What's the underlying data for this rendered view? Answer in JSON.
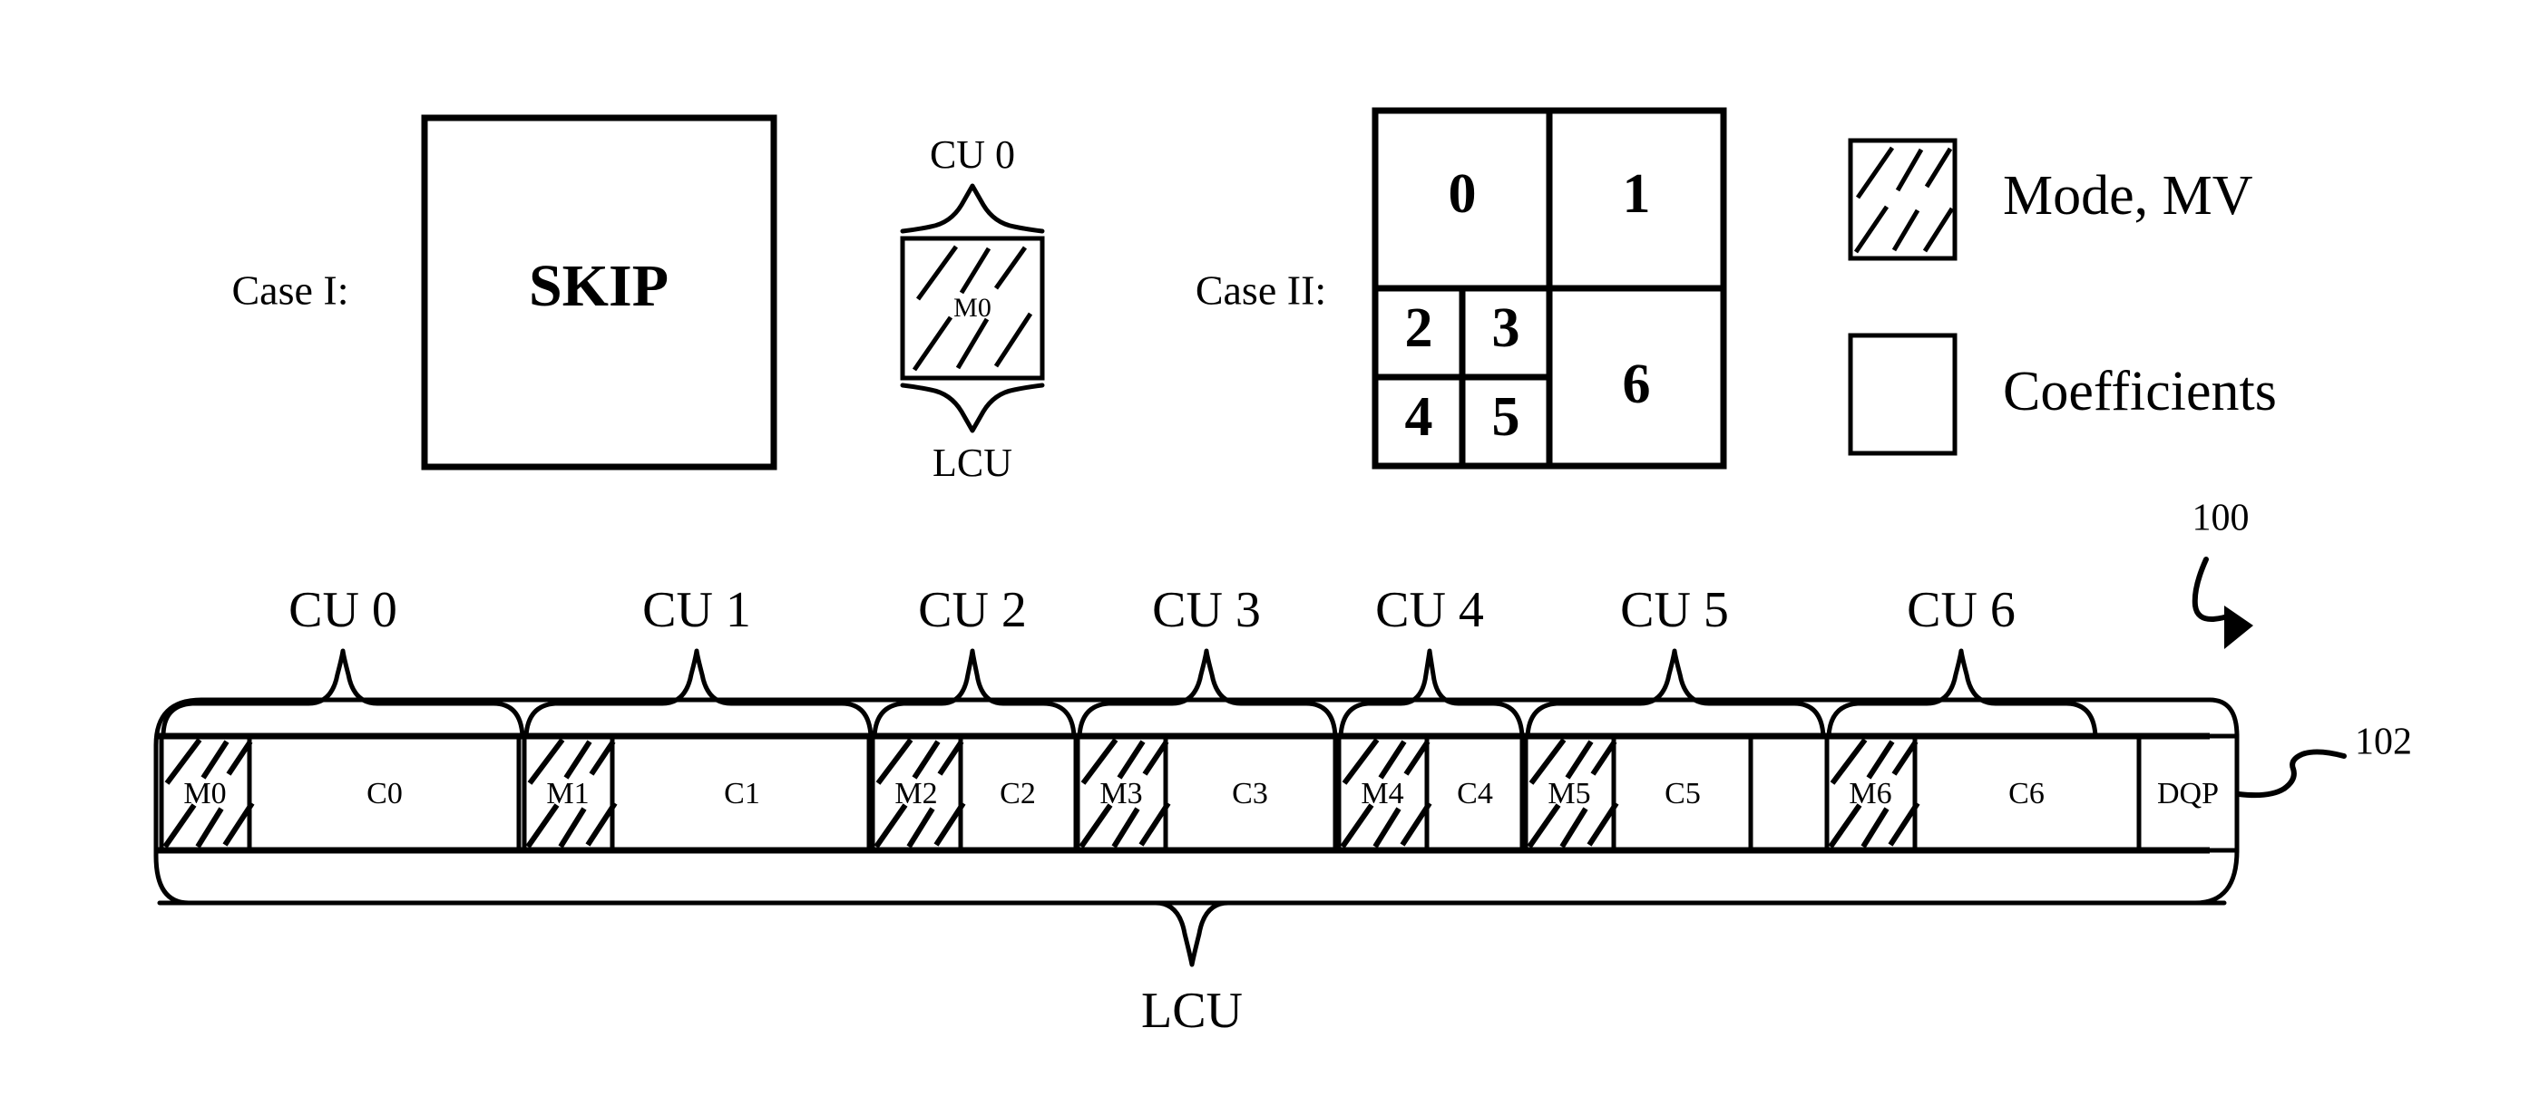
{
  "figure": {
    "reference_numeral_main": "100",
    "reference_numeral_bitstream": "102"
  },
  "case_one": {
    "label": "Case I:",
    "box_text": "SKIP",
    "cu_brace_label": "CU 0",
    "lcu_brace_label": "LCU",
    "unit_label": "M0"
  },
  "case_two": {
    "label": "Case II:",
    "blocks": [
      {
        "id": "0",
        "label": "0"
      },
      {
        "id": "1",
        "label": "1"
      },
      {
        "id": "2",
        "label": "2"
      },
      {
        "id": "3",
        "label": "3"
      },
      {
        "id": "4",
        "label": "4"
      },
      {
        "id": "5",
        "label": "5"
      },
      {
        "id": "6",
        "label": "6"
      }
    ]
  },
  "legend": {
    "items": [
      {
        "swatch": "hatched",
        "label": "Mode, MV"
      },
      {
        "swatch": "empty",
        "label": "Coefficients"
      }
    ]
  },
  "bitstream": {
    "cu_labels": [
      "CU 0",
      "CU 1",
      "CU 2",
      "CU 3",
      "CU 4",
      "CU 5",
      "CU 6"
    ],
    "lcu_label": "LCU",
    "cells": [
      {
        "label": "M0",
        "type": "mode"
      },
      {
        "label": "C0",
        "type": "coeff"
      },
      {
        "label": "M1",
        "type": "mode"
      },
      {
        "label": "C1",
        "type": "coeff"
      },
      {
        "label": "M2",
        "type": "mode"
      },
      {
        "label": "C2",
        "type": "coeff"
      },
      {
        "label": "M3",
        "type": "mode"
      },
      {
        "label": "C3",
        "type": "coeff"
      },
      {
        "label": "M4",
        "type": "mode"
      },
      {
        "label": "C4",
        "type": "coeff"
      },
      {
        "label": "M5",
        "type": "mode"
      },
      {
        "label": "C5",
        "type": "coeff"
      },
      {
        "label": "M6",
        "type": "mode"
      },
      {
        "label": "C6",
        "type": "coeff"
      },
      {
        "label": "DQP",
        "type": "dqp"
      }
    ]
  },
  "colors": {
    "stroke": "#000000",
    "background": "#ffffff"
  }
}
